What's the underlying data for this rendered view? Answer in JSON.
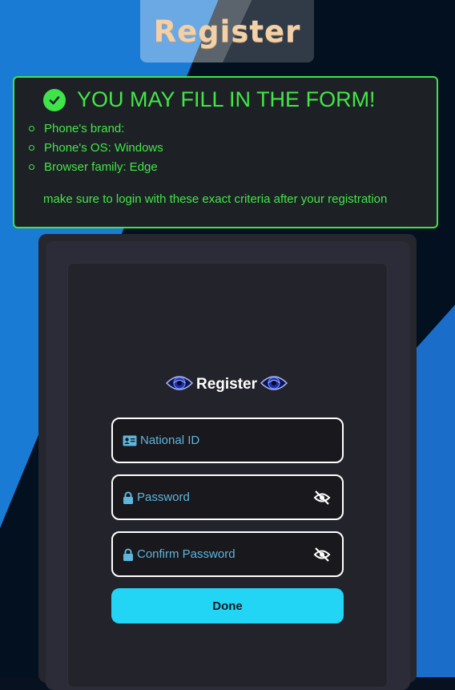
{
  "header": {
    "title": "Register"
  },
  "notice": {
    "title": "YOU MAY FILL IN THE FORM!",
    "items": [
      "Phone's brand:",
      "Phone's OS: Windows",
      "Browser family: Edge"
    ],
    "note": "make sure to login with these exact criteria after your registration",
    "color": "#42e646"
  },
  "form": {
    "title": "Register",
    "national_id_placeholder": "National ID",
    "password_placeholder": "Password",
    "confirm_password_placeholder": "Confirm Password",
    "submit_label": "Done",
    "accent": "#22d5f5"
  },
  "icons": [
    "check-circle-icon",
    "eye-icon",
    "id-card-icon",
    "lock-icon",
    "eye-off-icon"
  ]
}
